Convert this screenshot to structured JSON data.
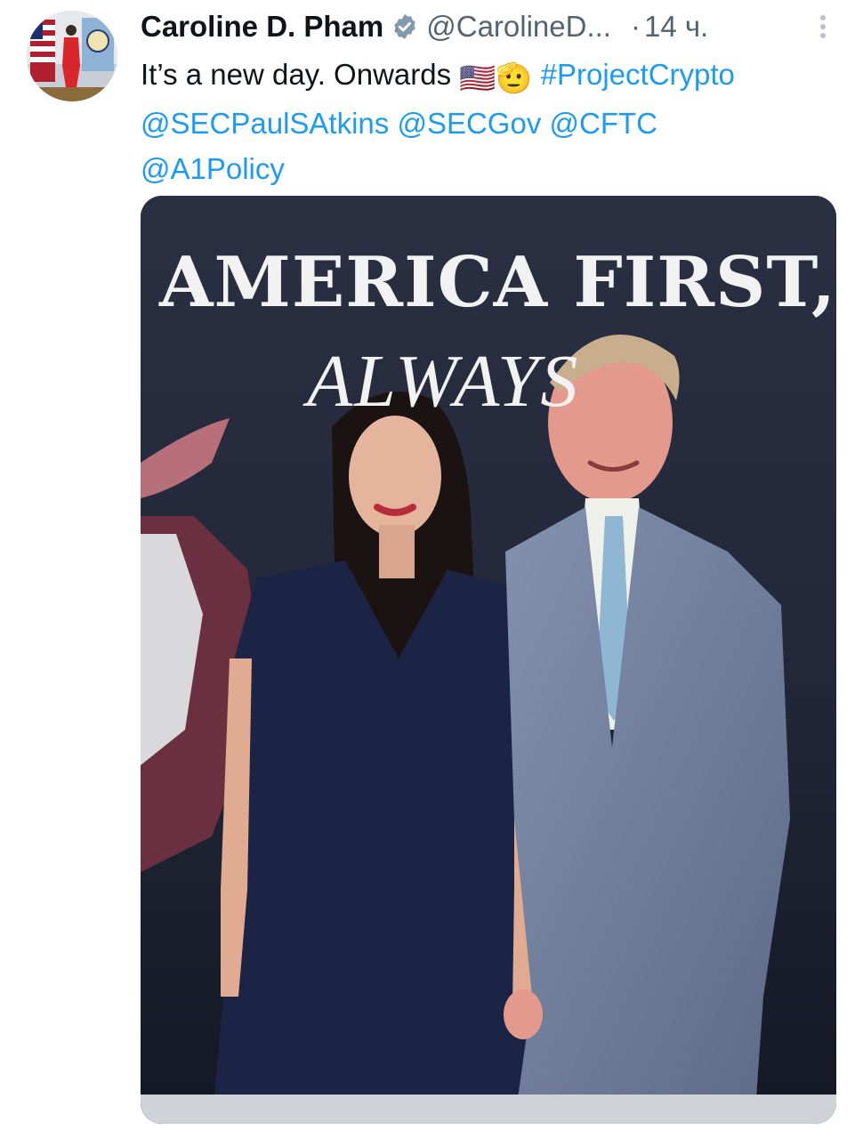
{
  "tweet": {
    "author_name": "Caroline D. Pham",
    "handle": "@CarolineD...",
    "separator": "·",
    "time": "14 ч.",
    "text_plain": "It’s a new day. Onwards ",
    "hashtag": "#ProjectCrypto",
    "mentions": [
      "@SECPaulSAtkins",
      "@SECGov",
      "@CFTC",
      "@A1Policy"
    ],
    "emoji_flag": "🇺🇸",
    "emoji_salute": "🫡"
  },
  "photo": {
    "banner_line1": "AMERICA FIRST,",
    "banner_line2": "ALWAYS"
  },
  "colors": {
    "link": "#1d9bf0",
    "text": "#0f1419",
    "secondary": "#536471",
    "verified_badge": "#829aab"
  },
  "icons": [
    "verified-badge-icon",
    "more-options-icon"
  ]
}
